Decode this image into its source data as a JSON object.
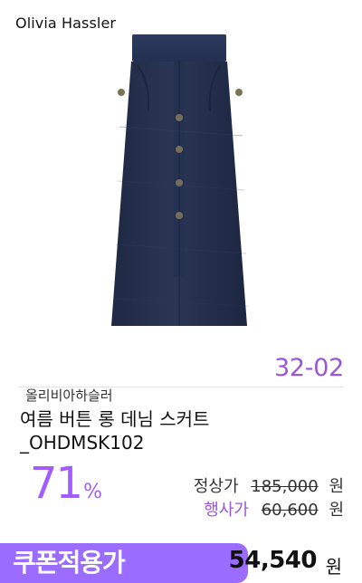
{
  "card": {
    "brand_logo": "Olivia Hassler",
    "event_code": "32-02",
    "brand_name": "올리비아하슬러",
    "product_name": "여름 버튼 롱 데님 스커트\n_OHDMSK102",
    "discount": {
      "value": "71",
      "unit": "%"
    },
    "prices": {
      "regular_label": "정상가",
      "regular_value": "185,000",
      "event_label": "행사가",
      "event_value": "60,600",
      "currency": "원"
    },
    "coupon": {
      "label": "쿠폰적용가",
      "price": "54,540",
      "currency": "원"
    }
  },
  "colors": {
    "accent": "#9a56d9",
    "coupon_bg": "#9a6cff",
    "denim": "#2b3654"
  },
  "icons": {
    "product_image": "skirt-image"
  }
}
